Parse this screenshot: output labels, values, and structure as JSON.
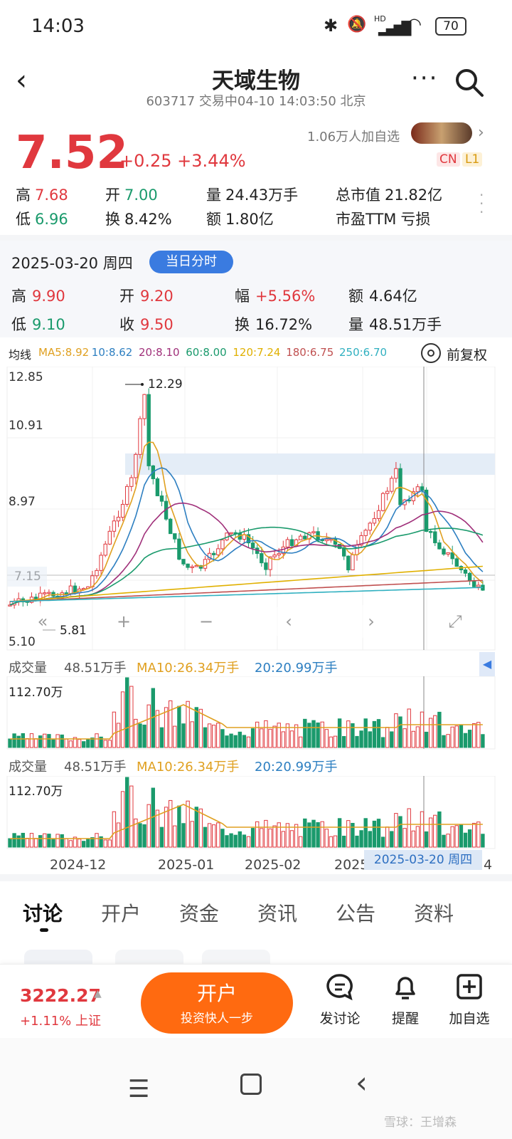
{
  "status": {
    "time": "14:03",
    "battery": "70",
    "hd": "HD"
  },
  "header": {
    "title": "天域生物",
    "subtitle": "603717 交易中04-10 14:03:50 北京",
    "followers": "1.06万人加自选",
    "badge_cn": "CN",
    "badge_l1": "L1"
  },
  "quote": {
    "price": "7.52",
    "change": "+0.25 +3.44%",
    "stats": [
      {
        "label": "高",
        "value": "7.68",
        "cls": "red"
      },
      {
        "label": "开",
        "value": "7.00",
        "cls": "green"
      },
      {
        "label": "量",
        "value": "24.43万手",
        "cls": ""
      },
      {
        "label": "总市值",
        "value": "21.82亿",
        "cls": ""
      },
      {
        "label": "低",
        "value": "6.96",
        "cls": "green"
      },
      {
        "label": "换",
        "value": "8.42%",
        "cls": ""
      },
      {
        "label": "额",
        "value": "1.80亿",
        "cls": ""
      },
      {
        "label": "市盈TTM",
        "value": "亏损",
        "cls": ""
      }
    ]
  },
  "day": {
    "date": "2025-03-20 周四",
    "button": "当日分时",
    "stats": [
      {
        "label": "高",
        "value": "9.90"
      },
      {
        "label": "开",
        "value": "9.20"
      },
      {
        "label": "幅",
        "value": "+5.56%"
      },
      {
        "label": "额",
        "value": "4.64亿"
      },
      {
        "label": "低",
        "value": "9.10"
      },
      {
        "label": "收",
        "value": "9.50"
      },
      {
        "label": "换",
        "value": "16.72%"
      },
      {
        "label": "量",
        "value": "48.51万手"
      }
    ]
  },
  "ma": {
    "label": "均线",
    "items": [
      {
        "text": "MA5:8.92",
        "color": "#e0a020"
      },
      {
        "text": "10:8.62",
        "color": "#2d7fc1"
      },
      {
        "text": "20:8.10",
        "color": "#a0307a"
      },
      {
        "text": "60:8.00",
        "color": "#1a9a6c"
      },
      {
        "text": "120:7.24",
        "color": "#e0b000"
      },
      {
        "text": "180:6.75",
        "color": "#c05050"
      },
      {
        "text": "250:6.70",
        "color": "#30b0c0"
      }
    ],
    "adjust": "前复权"
  },
  "kline": {
    "y_ticks": [
      "12.85",
      "10.91",
      "8.97",
      "7.15",
      "5.10"
    ],
    "high_mark": "12.29",
    "low_mark": "5.81"
  },
  "volume": {
    "label": "成交量",
    "value": "48.51万手",
    "ma10": "MA10:26.34万手",
    "ma20": "20:20.99万手",
    "max": "112.70万"
  },
  "x_axis": [
    "2024-12",
    "2025-01",
    "2025-02",
    "2025",
    "4"
  ],
  "cursor_date": "2025-03-20 周四",
  "tabs": [
    "讨论",
    "开户",
    "资金",
    "资讯",
    "公告",
    "资料"
  ],
  "bottom": {
    "index_value": "3222.27",
    "index_change": "+1.11% 上证",
    "open_title": "开户",
    "open_sub": "投资快人一步",
    "discuss": "发讨论",
    "remind": "提醒",
    "add": "加自选"
  },
  "watermark": "雪球：王增森"
}
